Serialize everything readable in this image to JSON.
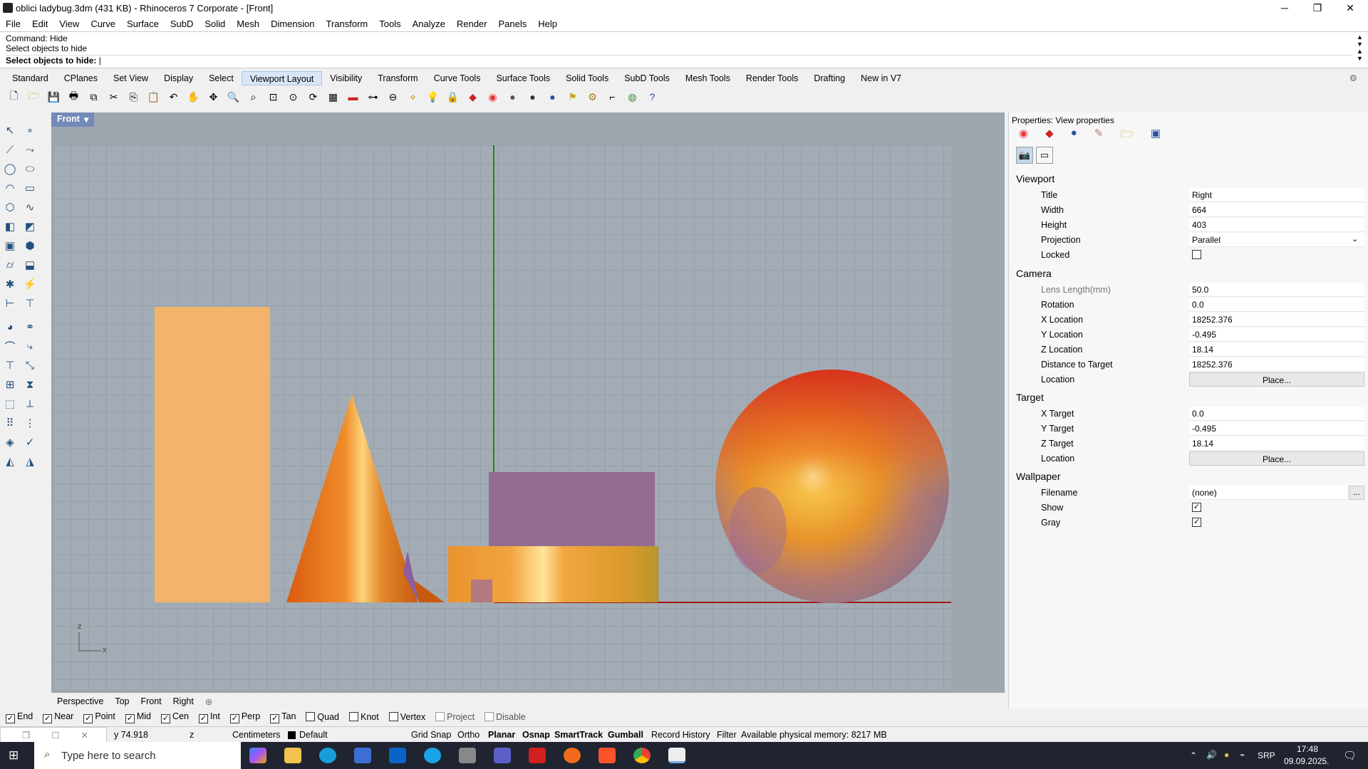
{
  "window": {
    "title": "oblici ladybug.3dm (431 KB) - Rhinoceros 7 Corporate - [Front]",
    "min": "─",
    "max": "❐",
    "close": "✕"
  },
  "menu": [
    "File",
    "Edit",
    "View",
    "Curve",
    "Surface",
    "SubD",
    "Solid",
    "Mesh",
    "Dimension",
    "Transform",
    "Tools",
    "Analyze",
    "Render",
    "Panels",
    "Help"
  ],
  "command": {
    "line1": "Command: Hide",
    "line2": "Select objects to hide",
    "prompt": "Select objects to hide:"
  },
  "toolbar_tabs": [
    "Standard",
    "CPlanes",
    "Set View",
    "Display",
    "Select",
    "Viewport Layout",
    "Visibility",
    "Transform",
    "Curve Tools",
    "Surface Tools",
    "Solid Tools",
    "SubD Tools",
    "Mesh Tools",
    "Render Tools",
    "Drafting",
    "New in V7"
  ],
  "active_tab": "Viewport Layout",
  "toolbar_icons": [
    "new-icon",
    "open-icon",
    "save-icon",
    "print-icon",
    "import-icon",
    "cut-icon",
    "copy-icon",
    "paste-icon",
    "undo-icon",
    "pan-icon",
    "rotate-icon",
    "zoom-icon",
    "zoom-window-icon",
    "zoom-extents-icon",
    "zoom-selected-icon",
    "rotate-view-icon",
    "four-views-icon",
    "car-icon",
    "named-views-icon",
    "cplane-icon",
    "snap-icon",
    "lightbulb-icon",
    "lock-icon",
    "layer-icon",
    "render-color-icon",
    "shade-icon",
    "rendered-icon",
    "render-sphere-icon",
    "lamp-icon",
    "gear-options-icon",
    "dimension-icon",
    "globe-icon",
    "help-icon"
  ],
  "colors": {
    "accent": "#7389b8",
    "rect": "#f2b46b",
    "box_top": "#936c92",
    "sphere_top": "#d8321a"
  },
  "viewport": {
    "name": "Front",
    "axis_z": "z",
    "axis_x": "x"
  },
  "viewport_tabs": [
    "Perspective",
    "Top",
    "Front",
    "Right"
  ],
  "properties": {
    "title": "Properties: View properties",
    "sections": {
      "viewport": "Viewport",
      "camera": "Camera",
      "target": "Target",
      "wallpaper": "Wallpaper"
    },
    "viewport_rows": [
      {
        "k": "Title",
        "v": "Right"
      },
      {
        "k": "Width",
        "v": "664"
      },
      {
        "k": "Height",
        "v": "403"
      },
      {
        "k": "Projection",
        "v": "Parallel"
      }
    ],
    "locked_label": "Locked",
    "camera_rows": [
      {
        "k": "Lens Length(mm)",
        "v": "50.0"
      },
      {
        "k": "Rotation",
        "v": "0.0"
      },
      {
        "k": "X Location",
        "v": "18252.376"
      },
      {
        "k": "Y Location",
        "v": "-0.495"
      },
      {
        "k": "Z Location",
        "v": "18.14"
      },
      {
        "k": "Distance to Target",
        "v": "18252.376"
      }
    ],
    "location_label": "Location",
    "place_button": "Place...",
    "target_rows": [
      {
        "k": "X Target",
        "v": "0.0"
      },
      {
        "k": "Y Target",
        "v": "-0.495"
      },
      {
        "k": "Z Target",
        "v": "18.14"
      }
    ],
    "filename_label": "Filename",
    "filename_value": "(none)",
    "browse_button": "...",
    "show_label": "Show",
    "gray_label": "Gray"
  },
  "osnaps": [
    {
      "label": "End",
      "checked": true
    },
    {
      "label": "Near",
      "checked": true
    },
    {
      "label": "Point",
      "checked": true
    },
    {
      "label": "Mid",
      "checked": true
    },
    {
      "label": "Cen",
      "checked": true
    },
    {
      "label": "Int",
      "checked": true
    },
    {
      "label": "Perp",
      "checked": true
    },
    {
      "label": "Tan",
      "checked": true
    },
    {
      "label": "Quad",
      "checked": false
    },
    {
      "label": "Knot",
      "checked": false
    },
    {
      "label": "Vertex",
      "checked": false
    },
    {
      "label": "Project",
      "checked": false
    },
    {
      "label": "Disable",
      "checked": false
    }
  ],
  "status": {
    "y": "y 74.918",
    "z": "z",
    "units": "Centimeters",
    "layer": "Default",
    "items": [
      "Grid Snap",
      "Ortho",
      "Planar",
      "Osnap",
      "SmartTrack",
      "Gumball",
      "Record History",
      "Filter"
    ],
    "bold_items": [
      "Planar",
      "Osnap",
      "SmartTrack",
      "Gumball"
    ],
    "memory": "Available physical memory: 8217 MB"
  },
  "taskbar": {
    "search": "Type here to search",
    "lang": "SRP",
    "time": "17:48",
    "date": "09.09.2025."
  }
}
